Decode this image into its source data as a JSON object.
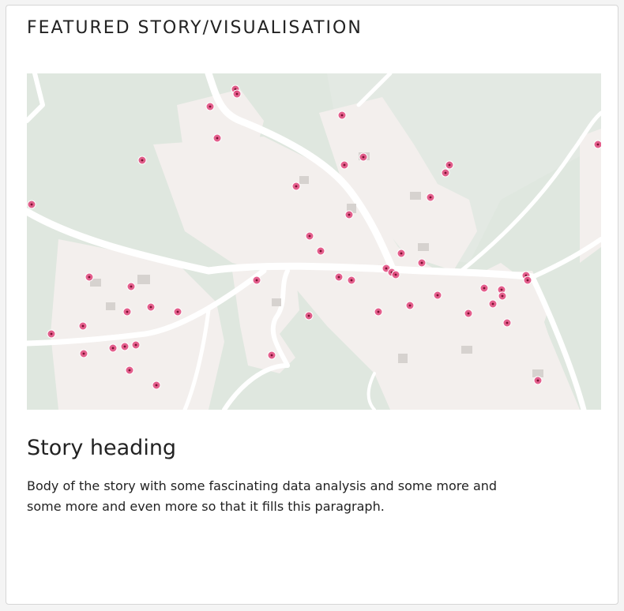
{
  "card": {
    "title": "FEATURED STORY/VISUALISATION"
  },
  "map": {
    "marker_color": "#e0457b",
    "land_color": "#f4f0ee",
    "green_color": "#dde5dd",
    "road_color": "#ffffff"
  },
  "story": {
    "heading": "Story heading",
    "body": "Body of the story with some fascinating data analysis and some more and some more and even more so that it fills this paragraph."
  }
}
